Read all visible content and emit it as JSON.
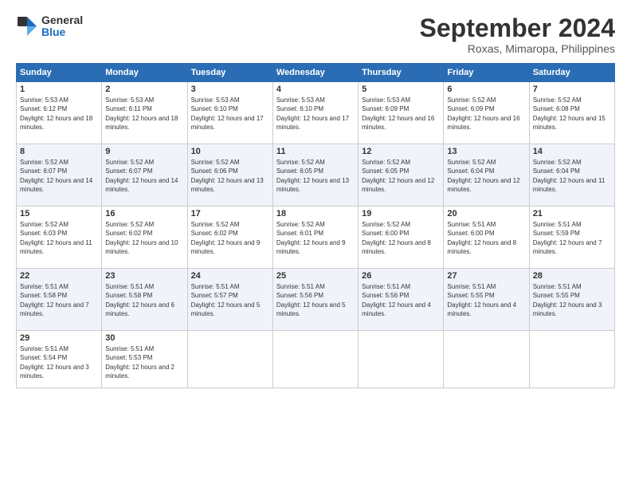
{
  "logo": {
    "general": "General",
    "blue": "Blue"
  },
  "header": {
    "month": "September 2024",
    "location": "Roxas, Mimaropa, Philippines"
  },
  "weekdays": [
    "Sunday",
    "Monday",
    "Tuesday",
    "Wednesday",
    "Thursday",
    "Friday",
    "Saturday"
  ],
  "weeks": [
    [
      {
        "day": "1",
        "sunrise": "5:53 AM",
        "sunset": "6:12 PM",
        "daylight": "12 hours and 18 minutes."
      },
      {
        "day": "2",
        "sunrise": "5:53 AM",
        "sunset": "6:11 PM",
        "daylight": "12 hours and 18 minutes."
      },
      {
        "day": "3",
        "sunrise": "5:53 AM",
        "sunset": "6:10 PM",
        "daylight": "12 hours and 17 minutes."
      },
      {
        "day": "4",
        "sunrise": "5:53 AM",
        "sunset": "6:10 PM",
        "daylight": "12 hours and 17 minutes."
      },
      {
        "day": "5",
        "sunrise": "5:53 AM",
        "sunset": "6:09 PM",
        "daylight": "12 hours and 16 minutes."
      },
      {
        "day": "6",
        "sunrise": "5:52 AM",
        "sunset": "6:09 PM",
        "daylight": "12 hours and 16 minutes."
      },
      {
        "day": "7",
        "sunrise": "5:52 AM",
        "sunset": "6:08 PM",
        "daylight": "12 hours and 15 minutes."
      }
    ],
    [
      {
        "day": "8",
        "sunrise": "5:52 AM",
        "sunset": "6:07 PM",
        "daylight": "12 hours and 14 minutes."
      },
      {
        "day": "9",
        "sunrise": "5:52 AM",
        "sunset": "6:07 PM",
        "daylight": "12 hours and 14 minutes."
      },
      {
        "day": "10",
        "sunrise": "5:52 AM",
        "sunset": "6:06 PM",
        "daylight": "12 hours and 13 minutes."
      },
      {
        "day": "11",
        "sunrise": "5:52 AM",
        "sunset": "6:05 PM",
        "daylight": "12 hours and 13 minutes."
      },
      {
        "day": "12",
        "sunrise": "5:52 AM",
        "sunset": "6:05 PM",
        "daylight": "12 hours and 12 minutes."
      },
      {
        "day": "13",
        "sunrise": "5:52 AM",
        "sunset": "6:04 PM",
        "daylight": "12 hours and 12 minutes."
      },
      {
        "day": "14",
        "sunrise": "5:52 AM",
        "sunset": "6:04 PM",
        "daylight": "12 hours and 11 minutes."
      }
    ],
    [
      {
        "day": "15",
        "sunrise": "5:52 AM",
        "sunset": "6:03 PM",
        "daylight": "12 hours and 11 minutes."
      },
      {
        "day": "16",
        "sunrise": "5:52 AM",
        "sunset": "6:02 PM",
        "daylight": "12 hours and 10 minutes."
      },
      {
        "day": "17",
        "sunrise": "5:52 AM",
        "sunset": "6:02 PM",
        "daylight": "12 hours and 9 minutes."
      },
      {
        "day": "18",
        "sunrise": "5:52 AM",
        "sunset": "6:01 PM",
        "daylight": "12 hours and 9 minutes."
      },
      {
        "day": "19",
        "sunrise": "5:52 AM",
        "sunset": "6:00 PM",
        "daylight": "12 hours and 8 minutes."
      },
      {
        "day": "20",
        "sunrise": "5:51 AM",
        "sunset": "6:00 PM",
        "daylight": "12 hours and 8 minutes."
      },
      {
        "day": "21",
        "sunrise": "5:51 AM",
        "sunset": "5:59 PM",
        "daylight": "12 hours and 7 minutes."
      }
    ],
    [
      {
        "day": "22",
        "sunrise": "5:51 AM",
        "sunset": "5:58 PM",
        "daylight": "12 hours and 7 minutes."
      },
      {
        "day": "23",
        "sunrise": "5:51 AM",
        "sunset": "5:58 PM",
        "daylight": "12 hours and 6 minutes."
      },
      {
        "day": "24",
        "sunrise": "5:51 AM",
        "sunset": "5:57 PM",
        "daylight": "12 hours and 5 minutes."
      },
      {
        "day": "25",
        "sunrise": "5:51 AM",
        "sunset": "5:56 PM",
        "daylight": "12 hours and 5 minutes."
      },
      {
        "day": "26",
        "sunrise": "5:51 AM",
        "sunset": "5:56 PM",
        "daylight": "12 hours and 4 minutes."
      },
      {
        "day": "27",
        "sunrise": "5:51 AM",
        "sunset": "5:55 PM",
        "daylight": "12 hours and 4 minutes."
      },
      {
        "day": "28",
        "sunrise": "5:51 AM",
        "sunset": "5:55 PM",
        "daylight": "12 hours and 3 minutes."
      }
    ],
    [
      {
        "day": "29",
        "sunrise": "5:51 AM",
        "sunset": "5:54 PM",
        "daylight": "12 hours and 3 minutes."
      },
      {
        "day": "30",
        "sunrise": "5:51 AM",
        "sunset": "5:53 PM",
        "daylight": "12 hours and 2 minutes."
      },
      null,
      null,
      null,
      null,
      null
    ]
  ]
}
